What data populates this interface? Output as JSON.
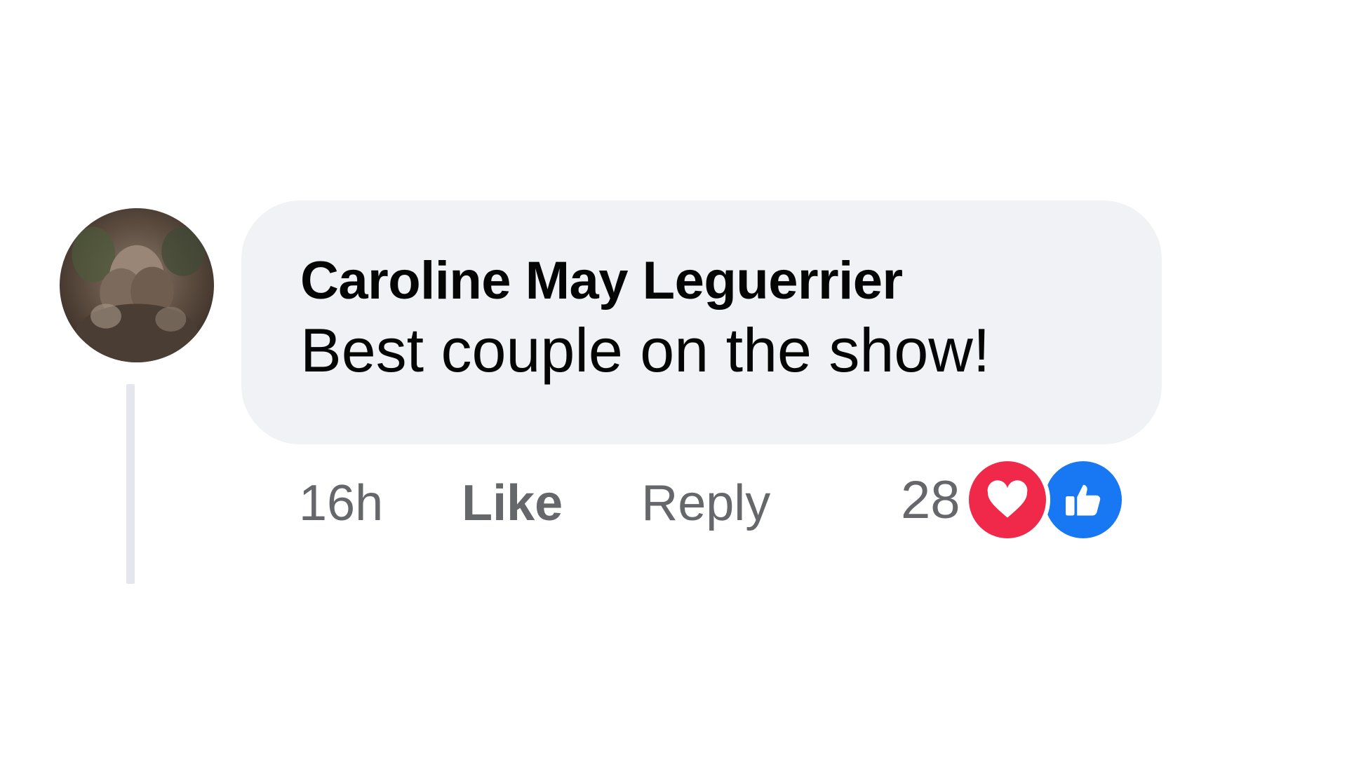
{
  "comment": {
    "author": "Caroline May Leguerrier",
    "text": "Best couple on the show!",
    "timestamp": "16h",
    "like_label": "Like",
    "reply_label": "Reply",
    "reaction_count": "28",
    "reactions": [
      {
        "icon": "heart-icon",
        "color": "#f02849"
      },
      {
        "icon": "thumbs-up-icon",
        "color": "#1877f2"
      }
    ]
  },
  "colors": {
    "bubble": "#f0f2f5",
    "text": "#050505",
    "secondary": "#65676b",
    "thread_line": "#e4e6eb"
  }
}
